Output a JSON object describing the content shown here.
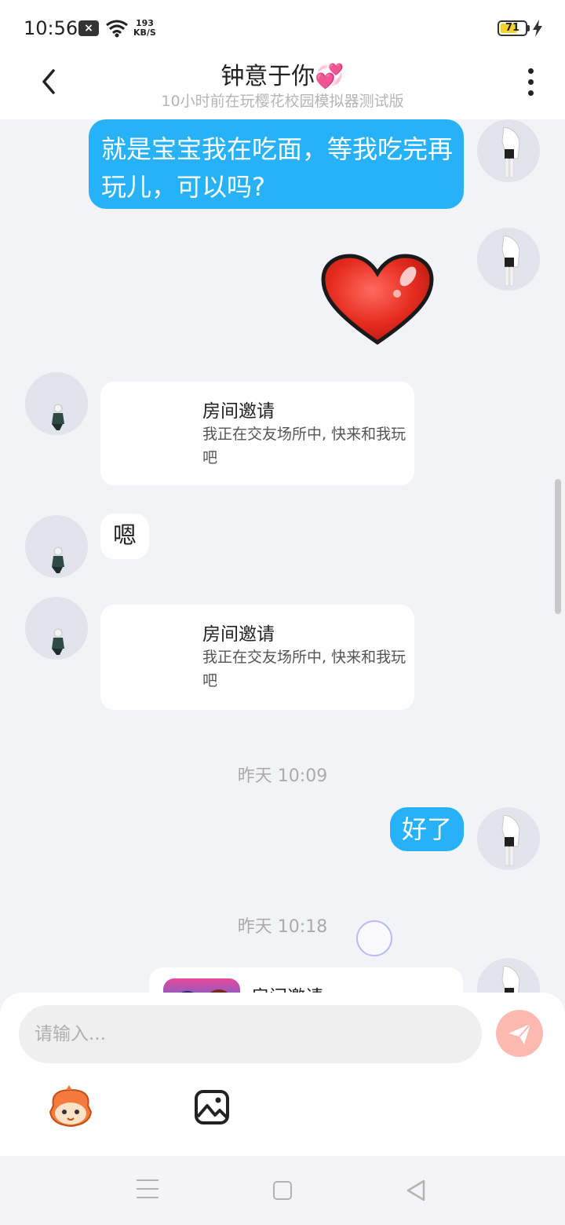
{
  "status_bar": {
    "time": "10:56",
    "net_speed_value": "193",
    "net_speed_unit": "KB/S",
    "battery_level": "71",
    "battery_color": "#f6d130"
  },
  "header": {
    "title": "钟意于你💞",
    "subtitle": "10小时前在玩樱花校园模拟器测试版",
    "back_icon": "chevron-left-icon",
    "more_icon": "more-vertical-icon"
  },
  "messages": [
    {
      "side": "right",
      "type": "text",
      "text": "就是宝宝我在吃面，等我吃完再玩儿，可以吗?"
    },
    {
      "side": "right",
      "type": "sticker",
      "sticker": "red-heart"
    },
    {
      "side": "left",
      "type": "invite",
      "title": "房间邀请",
      "desc": "我正在交友场所中, 快来和我玩吧"
    },
    {
      "side": "left",
      "type": "text",
      "text": "嗯"
    },
    {
      "side": "left",
      "type": "invite",
      "title": "房间邀请",
      "desc": "我正在交友场所中, 快来和我玩吧"
    },
    {
      "type": "time",
      "text": "昨天 10:09"
    },
    {
      "side": "right",
      "type": "text",
      "text": "好了"
    },
    {
      "type": "time",
      "text": "昨天 10:18"
    },
    {
      "side": "right",
      "type": "invite",
      "title": "房间邀请"
    }
  ],
  "input": {
    "placeholder": "请输入...",
    "value": "",
    "send_icon": "send-icon",
    "emoji_icon": "emoji-face-icon",
    "image_icon": "image-icon"
  },
  "colors": {
    "accent_blue": "#27b2f7",
    "send_button": "#fbb9b0",
    "background": "#f2f3f7"
  }
}
